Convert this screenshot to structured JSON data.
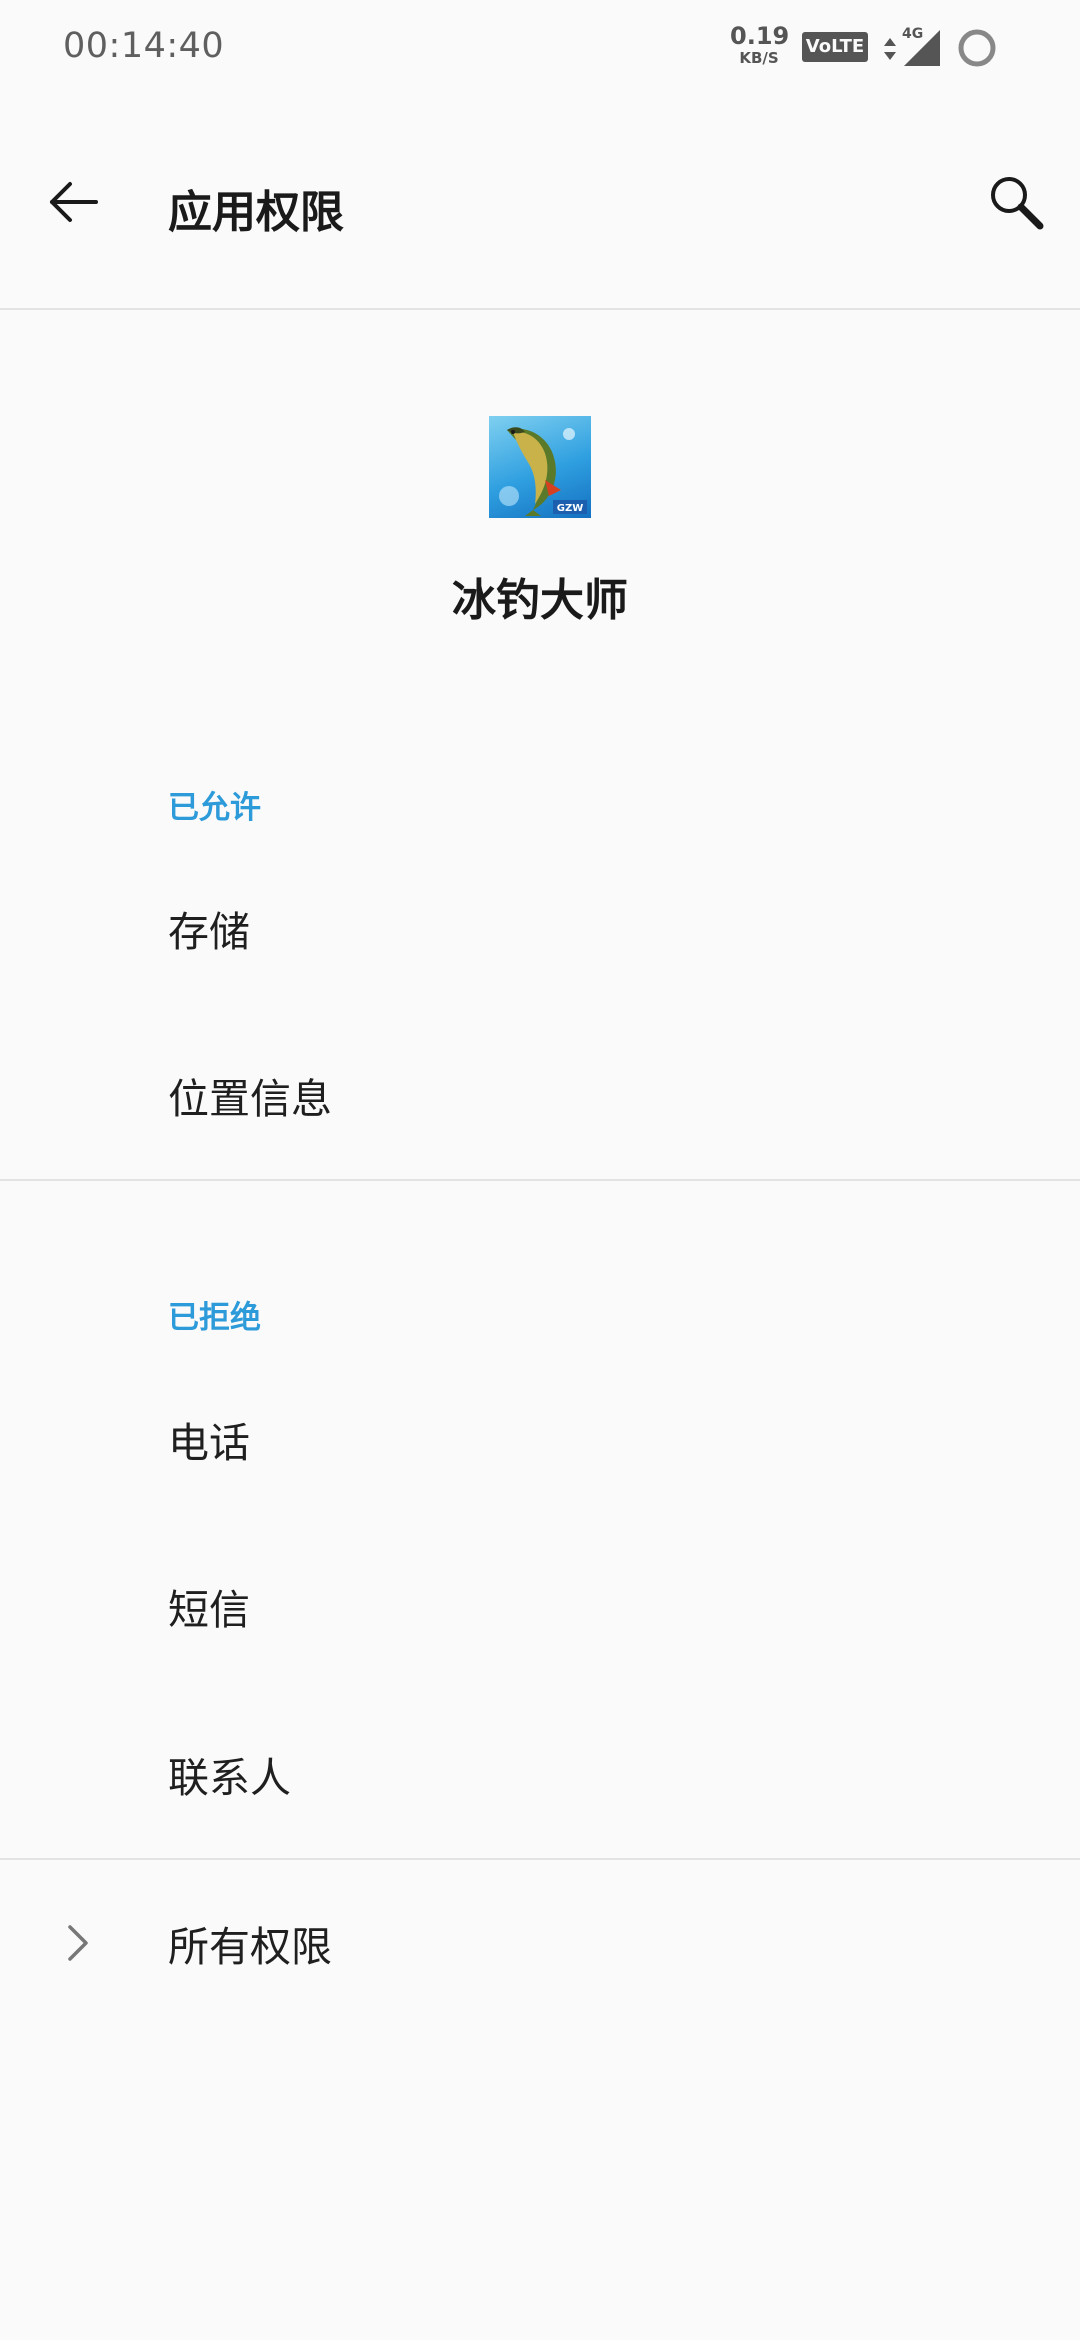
{
  "status_bar": {
    "time": "00:14:40",
    "speed_value": "0.19",
    "speed_unit": "KB/S",
    "volte": "VoLTE",
    "network": "4G",
    "icons": [
      "data-arrows-icon",
      "signal-icon",
      "battery-ring-icon"
    ]
  },
  "app_bar": {
    "title": "应用权限",
    "back_icon": "arrow-left-icon",
    "search_icon": "search-icon"
  },
  "app": {
    "name": "冰钓大师",
    "icon": "fish-app-icon",
    "icon_badge": "GZW"
  },
  "allowed": {
    "label": "已允许",
    "items": [
      "存储",
      "位置信息"
    ]
  },
  "denied": {
    "label": "已拒绝",
    "items": [
      "电话",
      "短信",
      "联系人"
    ]
  },
  "all_permissions": {
    "label": "所有权限",
    "icon": "chevron-right-icon"
  },
  "colors": {
    "accent": "#2d9ad9",
    "background": "#fafafa",
    "divider": "#e3e3e3"
  }
}
